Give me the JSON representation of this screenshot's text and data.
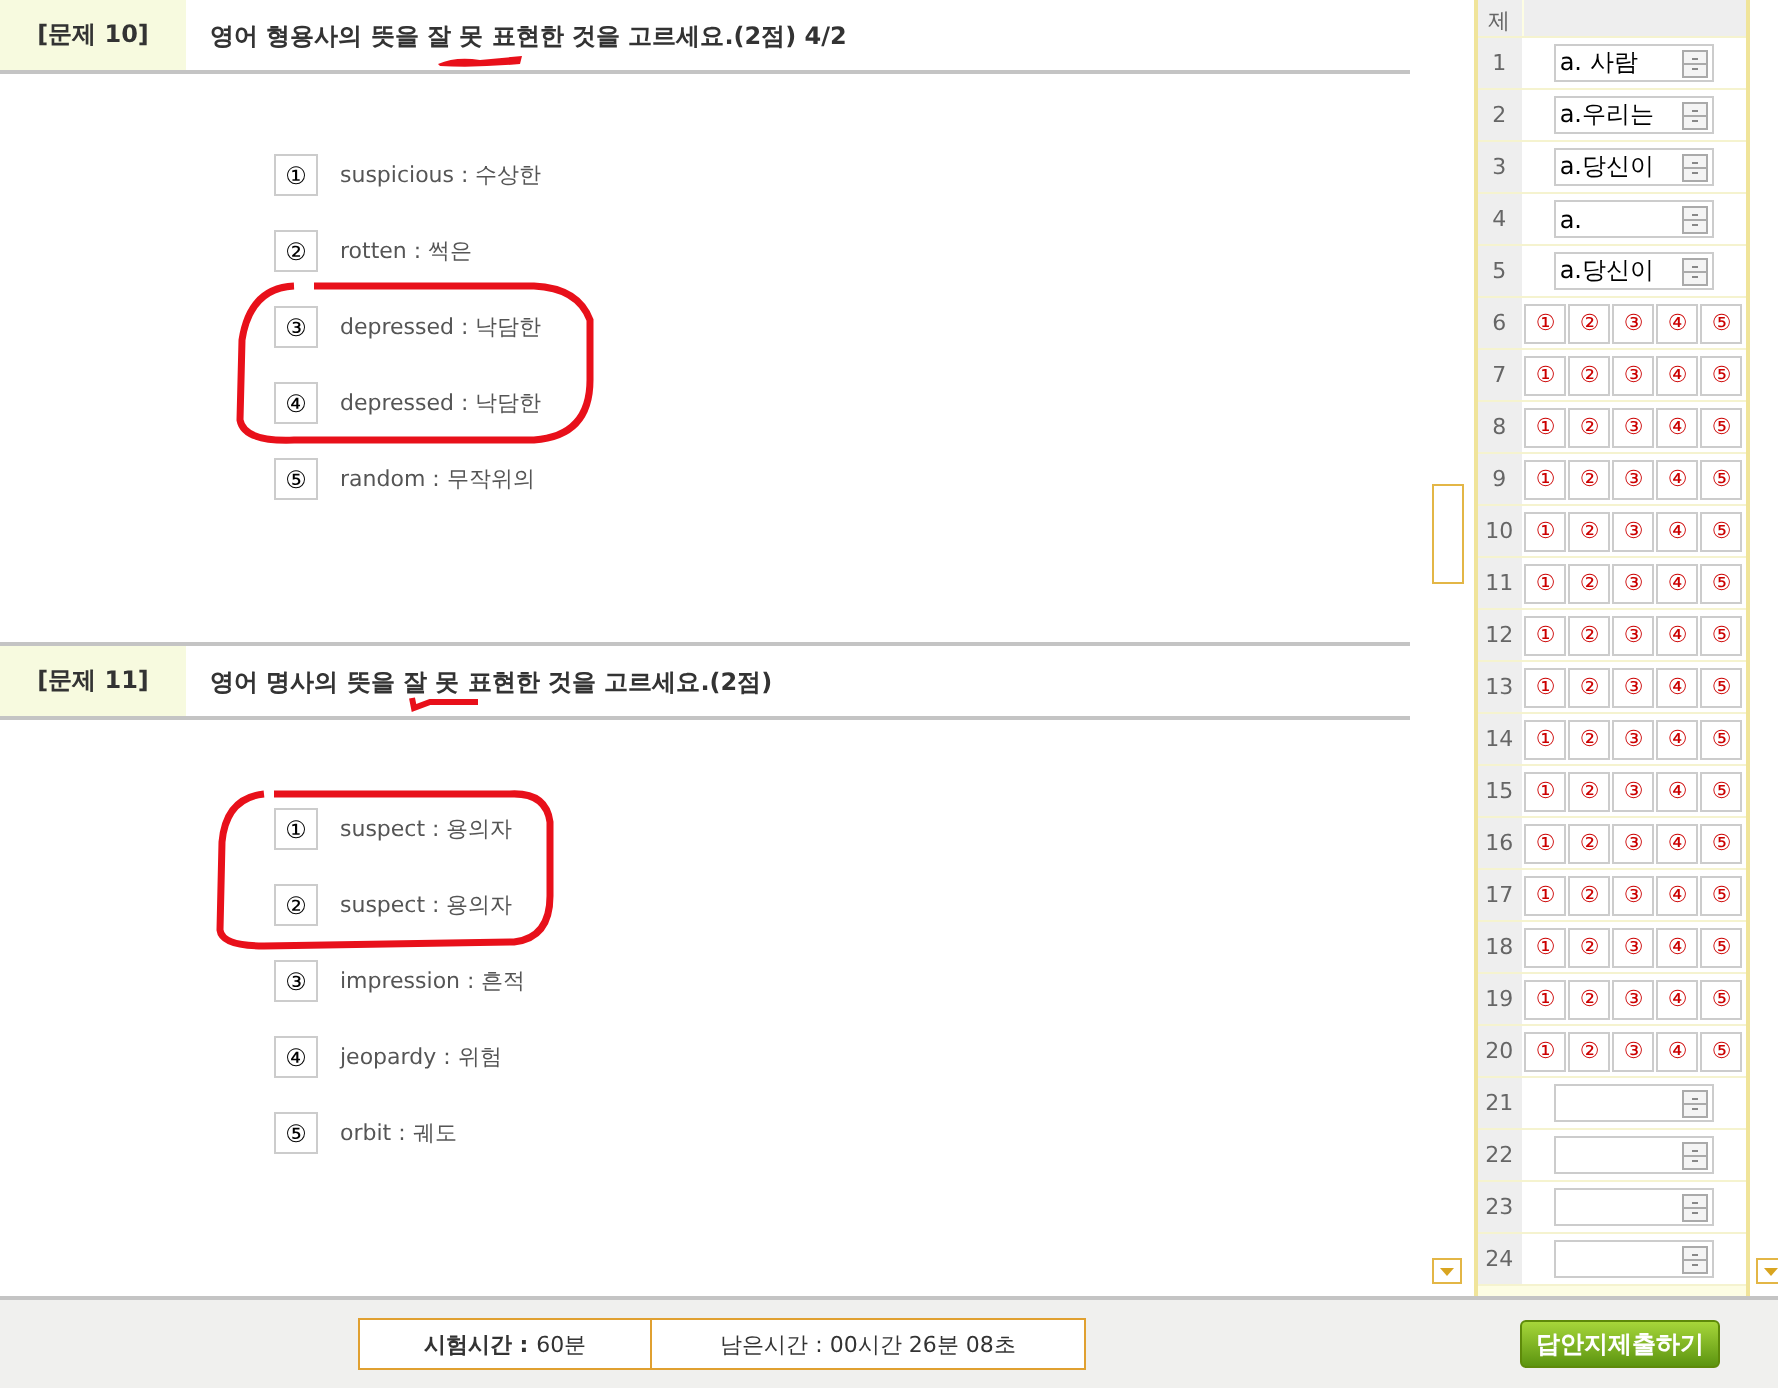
{
  "questions": [
    {
      "label": "[문제 10]",
      "prompt": "영어 형용사의 뜻을 잘 못 표현한 것을 고르세요.(2점) 4/2",
      "options": [
        {
          "number": "①",
          "text": "suspicious : 수상한"
        },
        {
          "number": "②",
          "text": "rotten : 썩은"
        },
        {
          "number": "③",
          "text": "depressed : 낙담한"
        },
        {
          "number": "④",
          "text": "depressed : 낙담한"
        },
        {
          "number": "⑤",
          "text": "random : 무작위의"
        }
      ]
    },
    {
      "label": "[문제 11]",
      "prompt": "영어 명사의 뜻을 잘 못 표현한 것을 고르세요.(2점)",
      "options": [
        {
          "number": "①",
          "text": "suspect : 용의자"
        },
        {
          "number": "②",
          "text": "suspect : 용의자"
        },
        {
          "number": "③",
          "text": "impression : 흔적"
        },
        {
          "number": "④",
          "text": "jeopardy : 위험"
        },
        {
          "number": "⑤",
          "text": "orbit : 궤도"
        }
      ]
    }
  ],
  "answer_sheet": {
    "number_heading": "제",
    "rows": [
      {
        "number": "1",
        "kind": "text",
        "value": "a. 사람"
      },
      {
        "number": "2",
        "kind": "text",
        "value": "a.우리는"
      },
      {
        "number": "3",
        "kind": "text",
        "value": "a.당신이"
      },
      {
        "number": "4",
        "kind": "text",
        "value": "a."
      },
      {
        "number": "5",
        "kind": "text",
        "value": "a.당신이"
      },
      {
        "number": "6",
        "kind": "choice",
        "choices": [
          "①",
          "②",
          "③",
          "④",
          "⑤"
        ]
      },
      {
        "number": "7",
        "kind": "choice",
        "choices": [
          "①",
          "②",
          "③",
          "④",
          "⑤"
        ]
      },
      {
        "number": "8",
        "kind": "choice",
        "choices": [
          "①",
          "②",
          "③",
          "④",
          "⑤"
        ]
      },
      {
        "number": "9",
        "kind": "choice",
        "choices": [
          "①",
          "②",
          "③",
          "④",
          "⑤"
        ]
      },
      {
        "number": "10",
        "kind": "choice",
        "choices": [
          "①",
          "②",
          "③",
          "④",
          "⑤"
        ]
      },
      {
        "number": "11",
        "kind": "choice",
        "choices": [
          "①",
          "②",
          "③",
          "④",
          "⑤"
        ]
      },
      {
        "number": "12",
        "kind": "choice",
        "choices": [
          "①",
          "②",
          "③",
          "④",
          "⑤"
        ]
      },
      {
        "number": "13",
        "kind": "choice",
        "choices": [
          "①",
          "②",
          "③",
          "④",
          "⑤"
        ]
      },
      {
        "number": "14",
        "kind": "choice",
        "choices": [
          "①",
          "②",
          "③",
          "④",
          "⑤"
        ]
      },
      {
        "number": "15",
        "kind": "choice",
        "choices": [
          "①",
          "②",
          "③",
          "④",
          "⑤"
        ]
      },
      {
        "number": "16",
        "kind": "choice",
        "choices": [
          "①",
          "②",
          "③",
          "④",
          "⑤"
        ]
      },
      {
        "number": "17",
        "kind": "choice",
        "choices": [
          "①",
          "②",
          "③",
          "④",
          "⑤"
        ]
      },
      {
        "number": "18",
        "kind": "choice",
        "choices": [
          "①",
          "②",
          "③",
          "④",
          "⑤"
        ]
      },
      {
        "number": "19",
        "kind": "choice",
        "choices": [
          "①",
          "②",
          "③",
          "④",
          "⑤"
        ]
      },
      {
        "number": "20",
        "kind": "choice",
        "choices": [
          "①",
          "②",
          "③",
          "④",
          "⑤"
        ]
      },
      {
        "number": "21",
        "kind": "text"
      },
      {
        "number": "22",
        "kind": "text"
      },
      {
        "number": "23",
        "kind": "text"
      },
      {
        "number": "24",
        "kind": "text"
      }
    ]
  },
  "footer": {
    "exam_time_label": "시험시간 :",
    "exam_time": "60분",
    "remaining_time": "남은시간 : 00시간 26분 08초",
    "submit": "답안지제출하기"
  }
}
